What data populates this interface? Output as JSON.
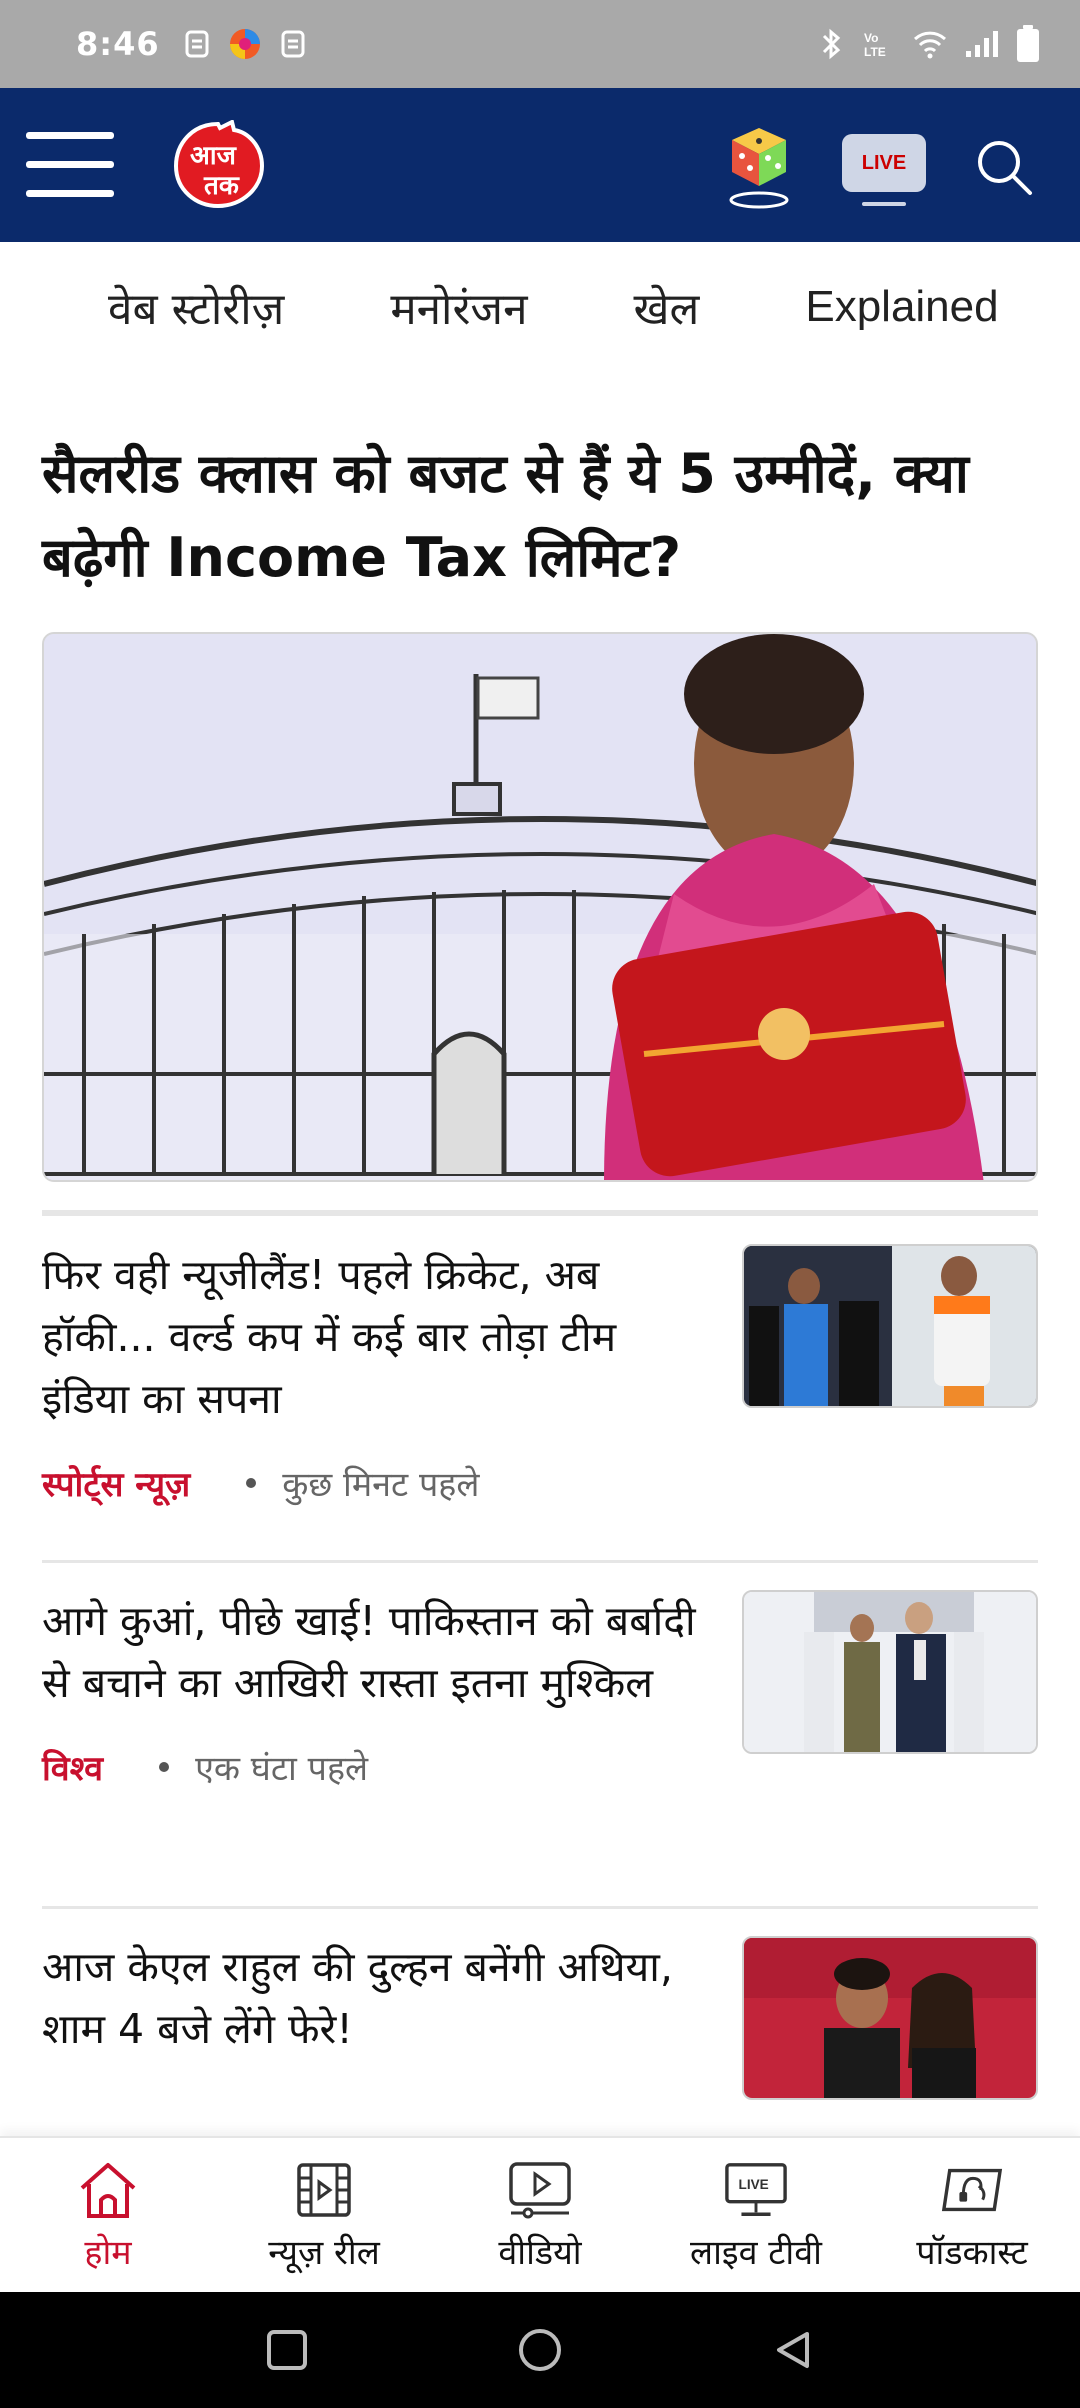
{
  "status_bar": {
    "time": "8:46",
    "icons": [
      "sim-icon",
      "browser-icon",
      "sim-icon",
      "bluetooth-icon",
      "volte-icon",
      "wifi-icon",
      "signal-icon",
      "battery-icon"
    ],
    "volte_label": "VoLTE"
  },
  "header": {
    "logo_text": "आज तक",
    "live_label": "LIVE",
    "brand_color": "#0b2a6b",
    "accent_color": "#c8102e"
  },
  "categories": [
    "वेब स्टोरीज़",
    "मनोरंजन",
    "खेल",
    "Explained"
  ],
  "lead": {
    "title": "सैलरीड क्लास को बजट से हैं ये 5 उम्मीदें, क्या बढ़ेगी Income Tax लिमिट?"
  },
  "news": [
    {
      "title": "फिर वही न्यूजीलैंड! पहले क्रिकेट, अब हॉकी... वर्ल्ड कप में कई बार तोड़ा टीम इंडिया का सपना",
      "category": "स्पोर्ट्स न्यूज़",
      "time": "कुछ मिनट पहले"
    },
    {
      "title": "आगे कुआं, पीछे खाई! पाकिस्तान को बर्बादी से बचाने का आखिरी रास्ता इतना मुश्किल",
      "category": "विश्व",
      "time": "एक घंटा पहले"
    },
    {
      "title": "आज केएल राहुल की दुल्हन बनेंगी अथिया, शाम 4 बजे लेंगे फेरे!",
      "category": "",
      "time": ""
    }
  ],
  "bottom_nav": [
    {
      "label": "होम",
      "icon": "home-icon",
      "active": true
    },
    {
      "label": "न्यूज़ रील",
      "icon": "news-reel-icon",
      "active": false
    },
    {
      "label": "वीडियो",
      "icon": "video-icon",
      "active": false
    },
    {
      "label": "लाइव टीवी",
      "icon": "live-tv-icon",
      "active": false,
      "badge": "LIVE"
    },
    {
      "label": "पॉडकास्ट",
      "icon": "podcast-icon",
      "active": false
    }
  ]
}
